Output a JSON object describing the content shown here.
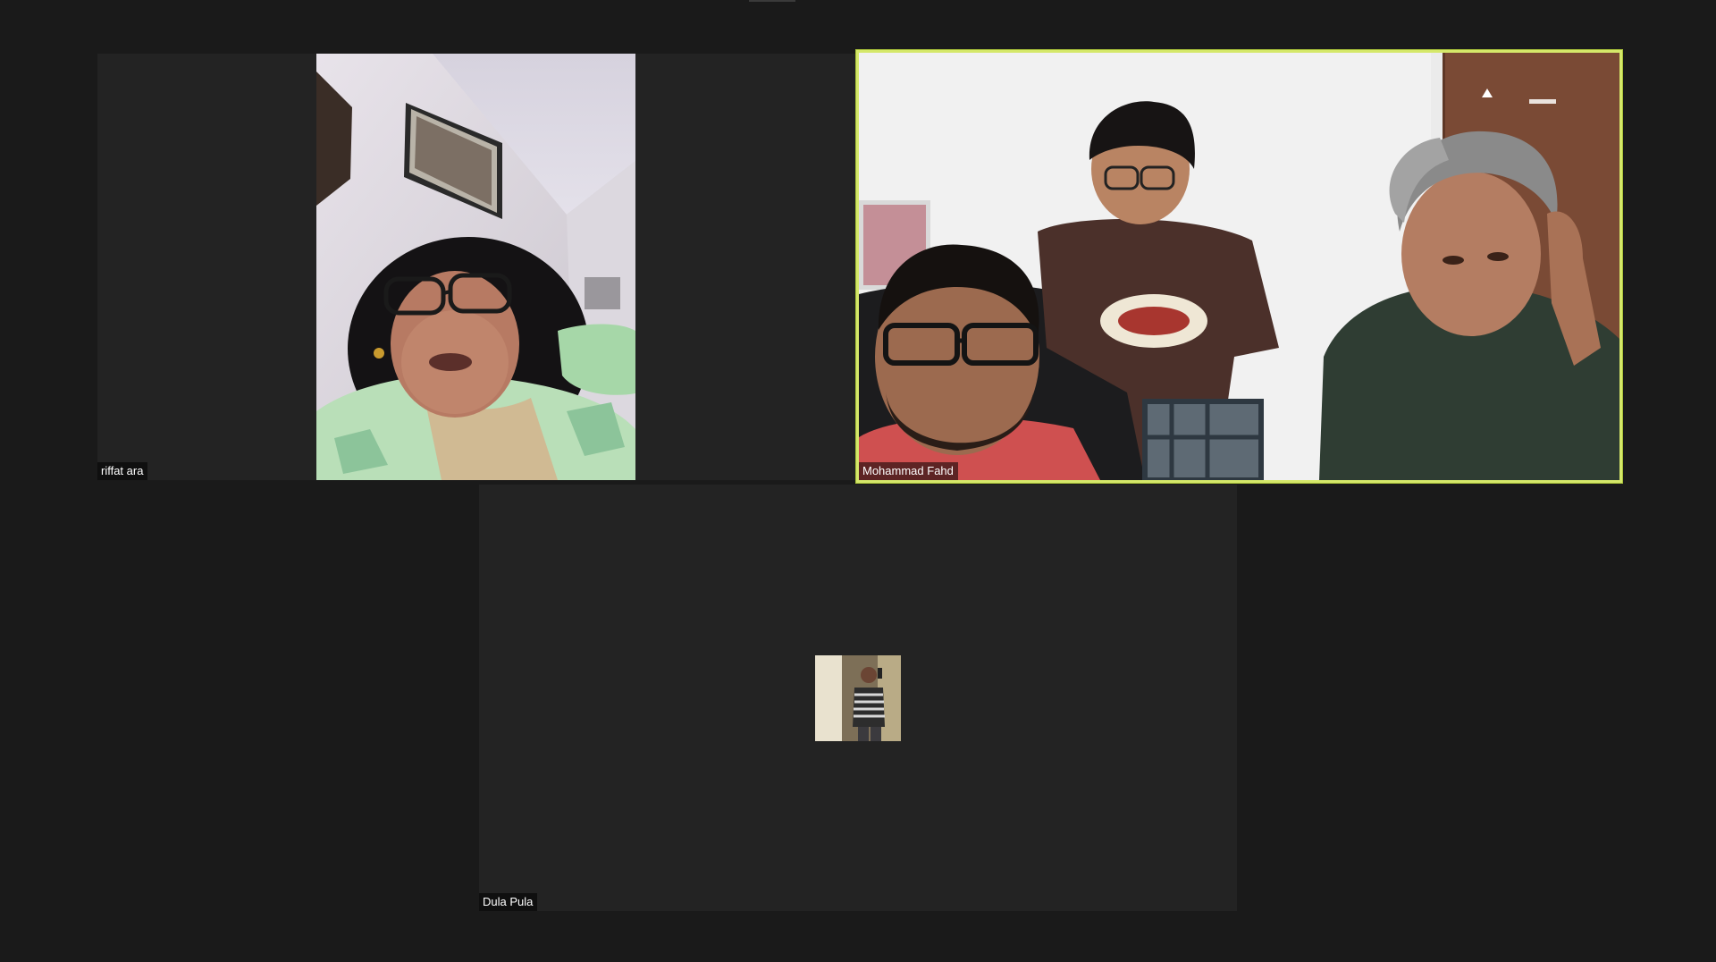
{
  "meeting": {
    "participants": [
      {
        "name": "riffat ara",
        "video": "on",
        "speaking": false
      },
      {
        "name": "Mohammad Fahd",
        "video": "on",
        "speaking": true
      },
      {
        "name": "Dula Pula",
        "video": "avatar-photo",
        "speaking": false
      }
    ],
    "colors": {
      "background": "#1a1a1a",
      "tile_background": "#232323",
      "active_speaker_border": "#d5e86a",
      "label_text": "#ffffff"
    }
  }
}
